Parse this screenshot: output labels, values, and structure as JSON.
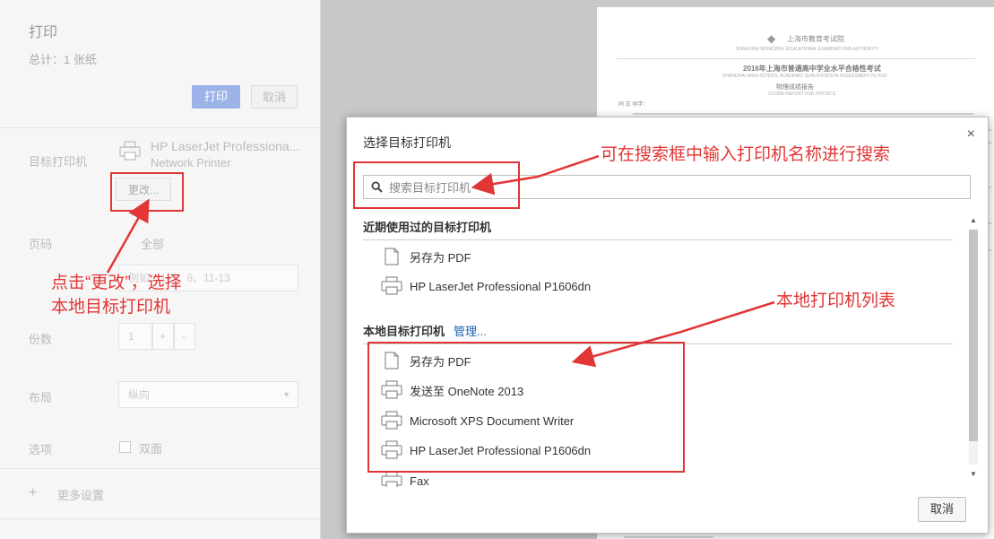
{
  "sidebar": {
    "title": "打印",
    "total_label": "总计：",
    "total_value": "1 张纸",
    "print_button": "打印",
    "cancel_button": "取消",
    "destination_label": "目标打印机",
    "destination_name": "HP LaserJet Professiona...",
    "destination_type": "Network Printer",
    "change_button": "更改...",
    "pages_label": "页码",
    "pages_value": "全部",
    "pages_placeholder": "例如：1-5、8、11-13",
    "copies_label": "份数",
    "copies_value": "1",
    "layout_label": "布局",
    "layout_value": "纵向",
    "options_label": "选项",
    "duplex_label": "双面",
    "more_settings": "更多设置"
  },
  "dialog": {
    "title": "选择目标打印机",
    "close_glyph": "×",
    "search_placeholder": "搜索目标打印机",
    "recent_title": "近期使用过的目标打印机",
    "recent_items": [
      {
        "label": "另存为 PDF",
        "icon": "pdf-document-icon"
      },
      {
        "label": "HP LaserJet Professional P1606dn",
        "icon": "printer-icon"
      }
    ],
    "local_title": "本地目标打印机",
    "manage_link": "管理...",
    "local_items": [
      {
        "label": "另存为 PDF",
        "icon": "pdf-document-icon"
      },
      {
        "label": "发送至 OneNote 2013",
        "icon": "printer-icon"
      },
      {
        "label": "Microsoft XPS Document Writer",
        "icon": "printer-icon"
      },
      {
        "label": "HP LaserJet Professional P1606dn",
        "icon": "printer-icon"
      },
      {
        "label": "Fax",
        "icon": "printer-icon"
      }
    ],
    "cancel_button": "取消"
  },
  "annotations": {
    "change_hint_line1": "点击“更改”，选择",
    "change_hint_line2": "本地目标打印机",
    "search_hint": "可在搜索框中输入打印机名称进行搜索",
    "local_list_hint": "本地打印机列表"
  },
  "document": {
    "authority": "上海市教育考试院",
    "authority_en": "SHANGHAI MUNICIPAL EDUCATIONAL EXAMINATIONS AUTHORITY",
    "exam_title": "2016年上海市普通高中学业水平合格性考试",
    "exam_title_en": "SHANGHAI HIGH-SCHOOL ACADEMIC QUALIFICATION ASSESSMENT IN 2016",
    "report_title": "物理成绩报告",
    "report_title_en": "SCORE REPORT FOR PHYSICS",
    "greeting": "同 志 同学："
  },
  "colors": {
    "annotation_red": "#e23535",
    "link_blue": "#1a5fb4",
    "print_button_bg": "#9cb3ea"
  }
}
